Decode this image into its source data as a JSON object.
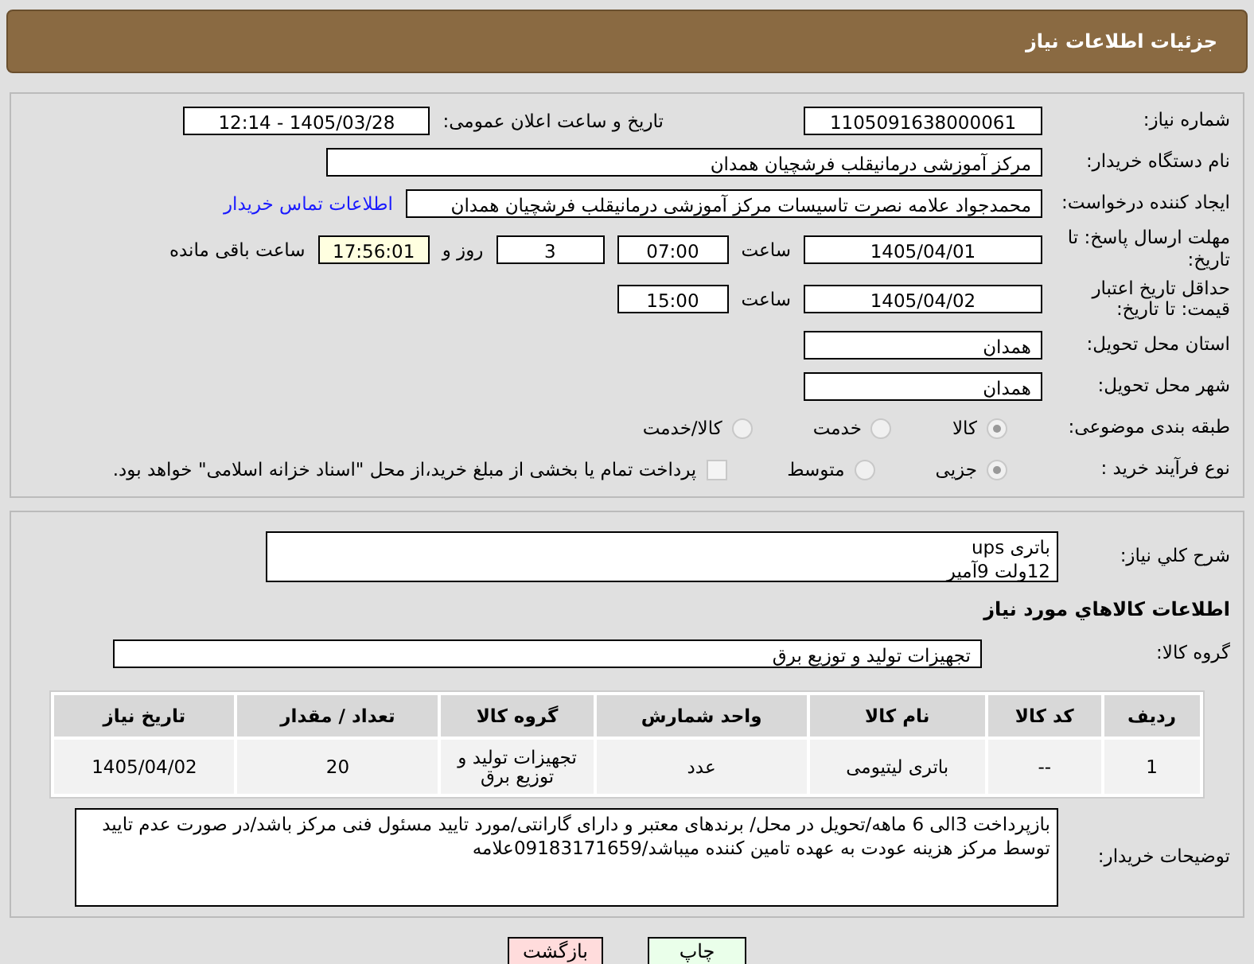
{
  "header": {
    "title": "جزئیات اطلاعات نیاز"
  },
  "details": {
    "need_number": {
      "label": "شماره نیاز:",
      "value": "1105091638000061"
    },
    "announce": {
      "label": "تاریخ و ساعت اعلان عمومی:",
      "value": "1405/03/28 - 12:14"
    },
    "buyer_org": {
      "label": "نام دستگاه خریدار:",
      "value": "مرکز آموزشی درمانیقلب فرشچیان همدان"
    },
    "creator": {
      "label": "ایجاد کننده درخواست:",
      "value": "محمدجواد علامه نصرت تاسیسات مرکز آموزشی درمانیقلب فرشچیان همدان",
      "link": "اطلاعات تماس خریدار"
    },
    "deadline": {
      "label": "مهلت ارسال پاسخ: تا تاریخ:",
      "date": "1405/04/01",
      "time_label": "ساعت",
      "time": "07:00",
      "days": "3",
      "days_label": "روز و",
      "remaining": "17:56:01",
      "remaining_label": "ساعت باقی مانده"
    },
    "validity": {
      "label": "حداقل تاریخ اعتبار قیمت: تا تاریخ:",
      "date": "1405/04/02",
      "time_label": "ساعت",
      "time": "15:00"
    },
    "province": {
      "label": "استان محل تحویل:",
      "value": "همدان"
    },
    "city": {
      "label": "شهر محل تحویل:",
      "value": "همدان"
    },
    "category": {
      "label": "طبقه بندی موضوعی:",
      "options": [
        {
          "label": "کالا",
          "selected": true
        },
        {
          "label": "خدمت",
          "selected": false
        },
        {
          "label": "کالا/خدمت",
          "selected": false
        }
      ]
    },
    "purchase_type": {
      "label": "نوع فرآیند خرید :",
      "options": [
        {
          "label": "جزیی",
          "selected": true
        },
        {
          "label": "متوسط",
          "selected": false
        }
      ],
      "treasury": {
        "label": "پرداخت تمام یا بخشی از مبلغ خرید،از محل \"اسناد خزانه اسلامی\" خواهد بود.",
        "checked": false
      }
    }
  },
  "need": {
    "description_label": "شرح کلي نیاز:",
    "description_lines": [
      "باتری ups",
      "12ولت 9آمپر"
    ],
    "goods_heading": "اطلاعات کالاهاي مورد نیاز",
    "group_label": "گروه کالا:",
    "group_value": "تجهیزات تولید و توزیع برق",
    "table": {
      "columns": [
        "ردیف",
        "کد کالا",
        "نام کالا",
        "واحد شمارش",
        "گروه کالا",
        "تعداد / مقدار",
        "تاریخ نیاز"
      ],
      "rows": [
        [
          "1",
          "--",
          "باتری لیتیومی",
          "عدد",
          "تجهیزات تولید و توزیع برق",
          "20",
          "1405/04/02"
        ]
      ]
    },
    "notes_label": "توضیحات خریدار:",
    "notes": "بازپرداخت 3الی 6 ماهه/تحویل در محل/ برندهای معتبر و دارای گارانتی/مورد تایید مسئول فنی مرکز باشد/در صورت عدم تایید توسط مرکز هزینه عودت به عهده تامین کننده میباشد/09183171659علامه"
  },
  "buttons": [
    {
      "kind": "print",
      "label": "چاپ"
    },
    {
      "kind": "back",
      "label": "بازگشت"
    }
  ]
}
